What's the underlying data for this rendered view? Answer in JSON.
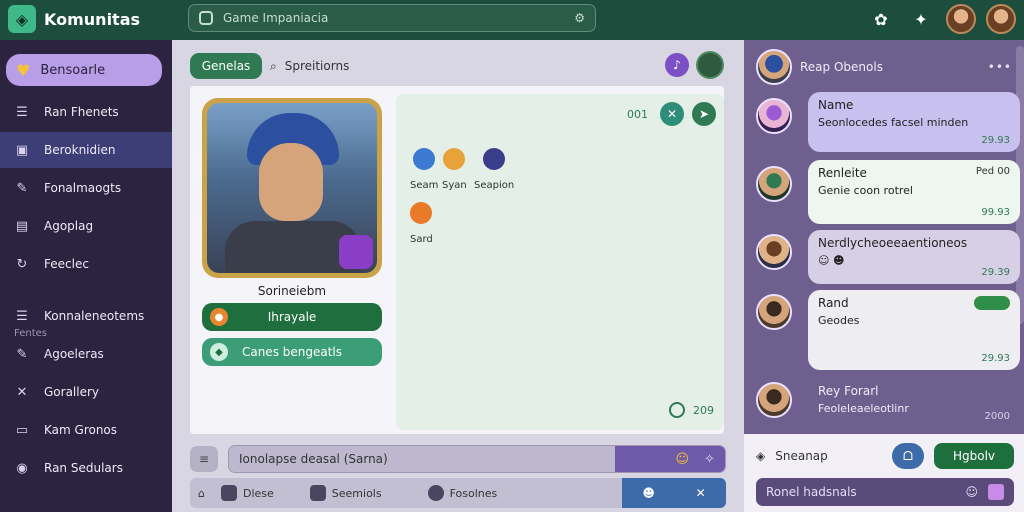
{
  "app": {
    "name": "Komunitas"
  },
  "search": {
    "value": "Game Impaniacia"
  },
  "sidebar": {
    "active": "Bensoarle",
    "items": [
      {
        "label": "Ran Fhenets",
        "icon": "list-icon"
      },
      {
        "label": "Beroknidien",
        "icon": "folder-icon"
      },
      {
        "label": "Fonalmaogts",
        "icon": "wrench-icon"
      },
      {
        "label": "Agoplag",
        "icon": "bag-icon"
      },
      {
        "label": "Feeclec",
        "icon": "refresh-icon"
      }
    ],
    "section": "Fentes",
    "items2": [
      {
        "label": "Konnaleneotems",
        "icon": "list-icon"
      },
      {
        "label": "Agoeleras",
        "icon": "wrench-icon"
      },
      {
        "label": "Gorallery",
        "icon": "tools-icon"
      },
      {
        "label": "Kam Gronos",
        "icon": "image-icon"
      },
      {
        "label": "Ran Sedulars",
        "icon": "radio-icon"
      }
    ]
  },
  "main": {
    "genre_chip": "Genelas",
    "search_tab": "Spreitiorns",
    "character_name": "Sorineiebm",
    "primary_button": "Ihrayale",
    "secondary_button": "Canes bengeatls",
    "panel": {
      "count": "001",
      "options": [
        "Seam",
        "Syan",
        "Seapion"
      ],
      "option2": "Sard",
      "footer_count": "209"
    },
    "composer_placeholder": "Ionolapse deasal (Sarna)",
    "bottom_tabs": [
      "Dlese",
      "Seemiols",
      "Fosolnes"
    ]
  },
  "right": {
    "header": "Reap Obenols",
    "messages": [
      {
        "name": "Name",
        "text": "Seonlocedes facsel minden",
        "time": "29.93"
      },
      {
        "name": "Renleite",
        "text": "Genie coon rotrel",
        "action": "Ped 00",
        "time": "99.93"
      },
      {
        "name": "Nerdlycheoeeaentioneos",
        "text": "",
        "time": "29.39"
      },
      {
        "name": "Rand",
        "text": "Geodes",
        "time": "29.93"
      },
      {
        "name": "Rey Forarl",
        "text": "Feoleleaeleotlinr",
        "time": "2000"
      }
    ],
    "footer_label": "Sneanap",
    "footer_button": "Hgbolv",
    "footer_input": "Ronel hadsnals"
  },
  "colors": {
    "topbar": "#1d4d3c",
    "sidebar": "#2b2340",
    "accent_green": "#1f6e3e",
    "accent_purple": "#7b50c4"
  }
}
